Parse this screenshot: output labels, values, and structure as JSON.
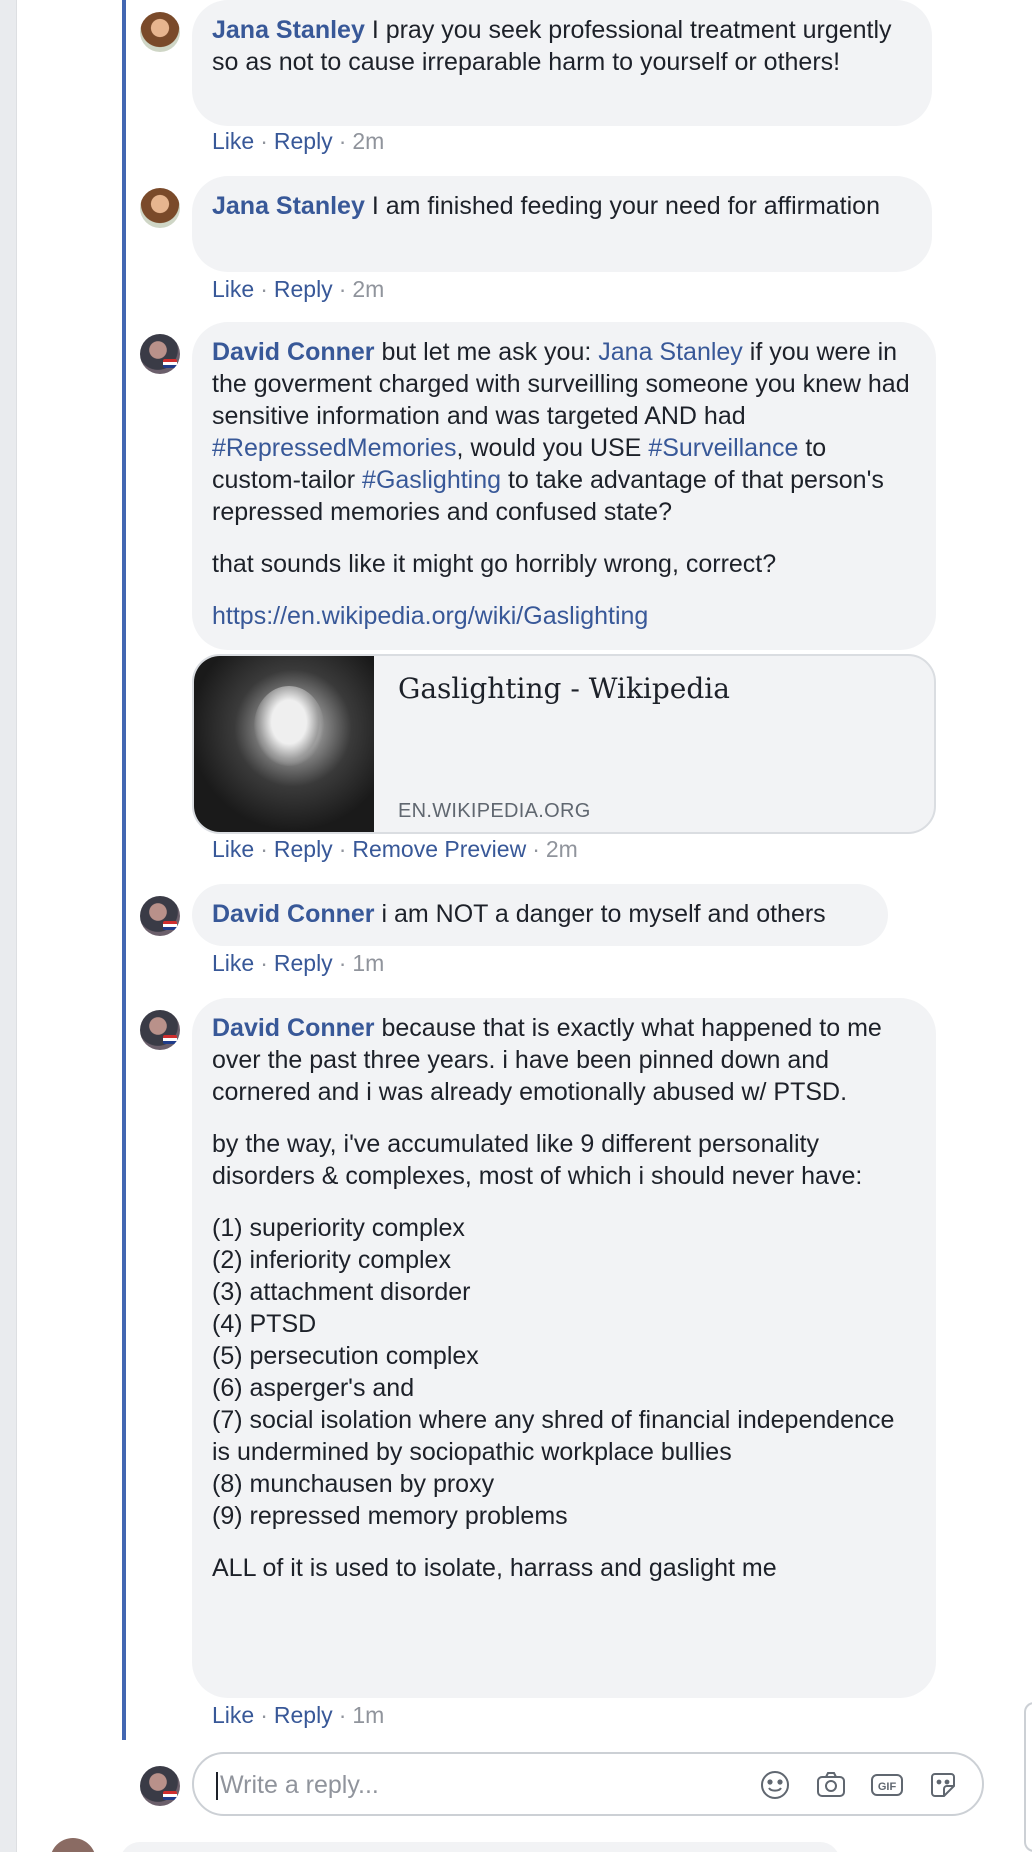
{
  "comments": [
    {
      "author": "Jana Stanley",
      "body": "I pray you seek professional treatment urgently so as not to cause irreparable harm to yourself or others!",
      "like": "Like",
      "reply": "Reply",
      "time": "2m"
    },
    {
      "author": "Jana Stanley",
      "body": "I am finished feeding your need for affirmation",
      "like": "Like",
      "reply": "Reply",
      "time": "2m"
    },
    {
      "author": "David Conner",
      "segments": [
        "but let me ask you: ",
        "Jana Stanley",
        " if you were in the goverment charged with surveilling someone you knew had sensitive information and was targeted AND had ",
        "#RepressedMemories",
        ", would you USE ",
        "#Surveillance",
        " to custom-tailor ",
        "#Gaslighting",
        " to take advantage of that person's repressed memories and confused state?"
      ],
      "paragraph2": "that sounds like it might go horribly wrong, correct?",
      "url": "https://en.wikipedia.org/wiki/Gaslighting",
      "preview": {
        "title": "Gaslighting - Wikipedia",
        "domain": "EN.WIKIPEDIA.ORG"
      },
      "like": "Like",
      "reply": "Reply",
      "remove_preview": "Remove Preview",
      "time": "2m"
    },
    {
      "author": "David Conner",
      "body": "i am NOT a danger to myself and others",
      "like": "Like",
      "reply": "Reply",
      "time": "1m"
    },
    {
      "author": "David Conner",
      "body": "because that is exactly what happened to me over the past three years. i have been pinned down and cornered and i was already emotionally abused w/ PTSD.",
      "paragraph2": "by the way, i've accumulated like 9 different personality disorders & complexes, most of which i should never have:",
      "list": [
        "(1) superiority complex",
        "(2) inferiority complex",
        "(3) attachment disorder",
        "(4) PTSD",
        "(5) persecution complex",
        "(6) asperger's and",
        "(7) social isolation where any shred of financial independence is undermined by sociopathic workplace bullies",
        "(8) munchausen by proxy",
        "(9) repressed memory problems"
      ],
      "paragraph4": "ALL of it is used to isolate, harrass and gaslight me",
      "like": "Like",
      "reply": "Reply",
      "time": "1m"
    }
  ],
  "reply_box": {
    "placeholder": "Write a reply...",
    "icons": [
      "emoji-icon",
      "camera-icon",
      "gif-icon",
      "sticker-icon"
    ],
    "gif_label": "GIF"
  },
  "colors": {
    "link": "#385898",
    "thread_line": "#4267b2",
    "bubble": "#f2f3f5",
    "meta": "#90949c"
  }
}
